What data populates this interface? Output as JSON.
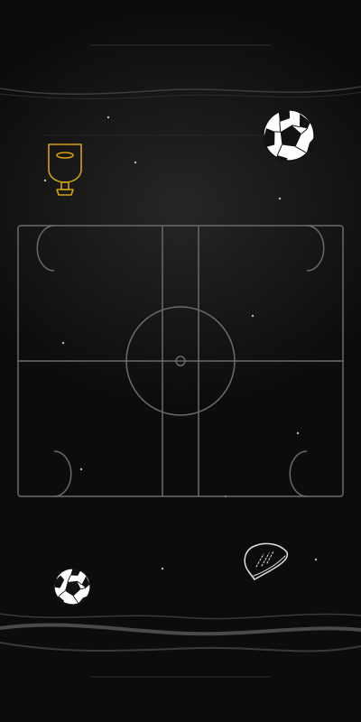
{
  "colors": {
    "background": "#0e0e0e",
    "field_lines": "#6b6b6b",
    "wave_lines": "#4a4a4a",
    "trophy": "#d4a017",
    "ball_fill": "#ffffff",
    "ball_patches": "#111111",
    "star": "#bdbdbd"
  },
  "icons": {
    "trophy": "trophy-icon",
    "ball_large": "soccer-ball-icon",
    "ball_small": "soccer-ball-icon",
    "cleat": "cleat-icon"
  }
}
